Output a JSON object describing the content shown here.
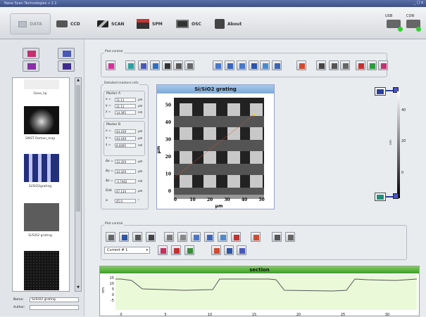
{
  "window": {
    "title": "Nano Scan Technologies v 1.1",
    "controls": "_ □ x"
  },
  "toolbar": {
    "data": "DATA",
    "ccd": "CCD",
    "scan": "SCAN",
    "spm": "SPM",
    "osc": "OSC",
    "about": "About",
    "usb1": "USB",
    "usb2": "CON"
  },
  "thumbnails": [
    {
      "label": "Gave_lip"
    },
    {
      "label": "SWST Raman_map"
    },
    {
      "label": "Si/SiO2grating"
    },
    {
      "label": "Si/SiO2 grating"
    },
    {
      "label": ""
    }
  ],
  "fields": {
    "name_label": "Name:",
    "name_value": "Si/SiO2 grating",
    "author_label": "Author:",
    "author_value": ""
  },
  "plot_control_title": "Plot control",
  "plot_control2_title": "Plot control",
  "markers": {
    "title": "Detailed markers info",
    "marker_a": "Marker A",
    "marker_b": "Marker B",
    "rows_a": [
      {
        "l": "x =",
        "v": "11.11",
        "u": "μm"
      },
      {
        "l": "y =",
        "v": "11.11",
        "u": "μm"
      },
      {
        "l": "z =",
        "v": "14.395",
        "u": "nm"
      }
    ],
    "rows_b": [
      {
        "l": "x =",
        "v": "44.439",
        "u": "μm"
      },
      {
        "l": "y =",
        "v": "44.439",
        "u": "μm"
      },
      {
        "l": "z =",
        "v": "8.6095",
        "u": "nm"
      }
    ],
    "rows_d": [
      {
        "l": "Δx =",
        "v": "33.329",
        "u": "μm"
      },
      {
        "l": "Δy =",
        "v": "33.329",
        "u": "μm"
      },
      {
        "l": "Δz =",
        "v": "-5.7462",
        "u": "nm"
      },
      {
        "l": "Dist",
        "v": "47.134",
        "u": "μm"
      },
      {
        "l": "α",
        "v": "45.0",
        "u": "°"
      }
    ]
  },
  "plot": {
    "title": "Si/SiO2 grating",
    "xlabel": "μm",
    "ylabel": "μm",
    "xticks": [
      "0",
      "10",
      "20",
      "30",
      "40",
      "50"
    ],
    "yticks": [
      "0",
      "10",
      "20",
      "30",
      "40",
      "50"
    ]
  },
  "colorbar": {
    "ticks": [
      "40",
      "20",
      "0"
    ],
    "unit": "nm"
  },
  "current": {
    "value": "Current # 1",
    "arrow": "▾"
  },
  "section": {
    "title": "section",
    "ylabel": "nm",
    "yticks": [
      "15",
      "10",
      "5",
      "0",
      "-5"
    ],
    "xticks": [
      "0",
      "5",
      "10",
      "15",
      "20",
      "25",
      "30"
    ]
  },
  "colors": {
    "accent": "#3d4f86",
    "plot_header": "#8fb7e0",
    "section_header": "#4caf38"
  }
}
